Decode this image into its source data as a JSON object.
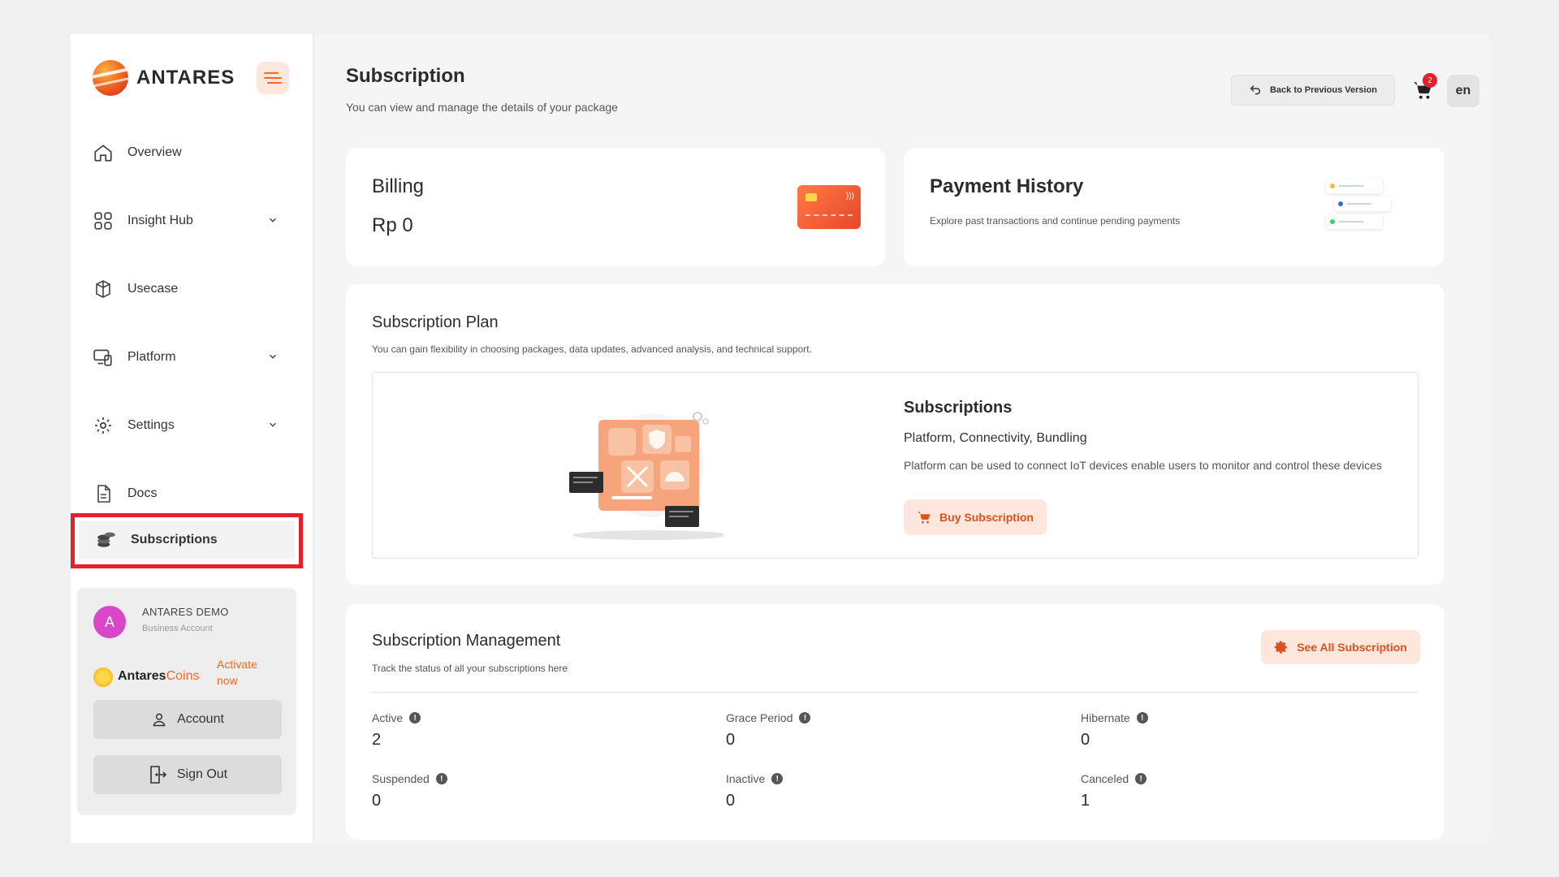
{
  "brand": {
    "name": "ANTARES"
  },
  "sidebar": {
    "items": [
      {
        "label": "Overview",
        "icon": "home-icon"
      },
      {
        "label": "Insight Hub",
        "icon": "grid-icon",
        "expandable": true
      },
      {
        "label": "Usecase",
        "icon": "usecase-icon"
      },
      {
        "label": "Platform",
        "icon": "devices-icon",
        "expandable": true
      },
      {
        "label": "Settings",
        "icon": "gear-icon",
        "expandable": true
      },
      {
        "label": "Docs",
        "icon": "document-icon"
      },
      {
        "label": "Subscriptions",
        "icon": "coins-icon",
        "active": true
      }
    ]
  },
  "user": {
    "initial": "A",
    "name": "ANTARES DEMO",
    "role": "Business Account",
    "coins_prefix": "Antares",
    "coins_suffix": "Coins",
    "activate": "Activate now",
    "account_label": "Account",
    "signout_label": "Sign Out"
  },
  "header": {
    "title": "Subscription",
    "subtitle": "You can view and manage the details of your package",
    "back_label": "Back to Previous Version",
    "cart_count": "2",
    "lang": "en"
  },
  "billing": {
    "title": "Billing",
    "amount": "Rp 0"
  },
  "payment_history": {
    "title": "Payment History",
    "description": "Explore past transactions and continue pending payments"
  },
  "plan": {
    "title": "Subscription Plan",
    "description": "You can gain flexibility in choosing packages, data updates, advanced analysis, and technical support.",
    "card_title": "Subscriptions",
    "card_kind": "Platform, Connectivity, Bundling",
    "card_desc": "Platform can be used to connect IoT devices enable users to monitor and control these devices",
    "buy_label": "Buy Subscription"
  },
  "management": {
    "title": "Subscription Management",
    "description": "Track the status of all your subscriptions here",
    "see_all_label": "See All Subscription",
    "stats": [
      {
        "label": "Active",
        "value": "2"
      },
      {
        "label": "Grace Period",
        "value": "0"
      },
      {
        "label": "Hibernate",
        "value": "0"
      },
      {
        "label": "Suspended",
        "value": "0"
      },
      {
        "label": "Inactive",
        "value": "0"
      },
      {
        "label": "Canceled",
        "value": "1"
      }
    ]
  },
  "colors": {
    "accent": "#f26b21",
    "highlight": "#e5202b",
    "accent_soft": "#fde6dc"
  }
}
